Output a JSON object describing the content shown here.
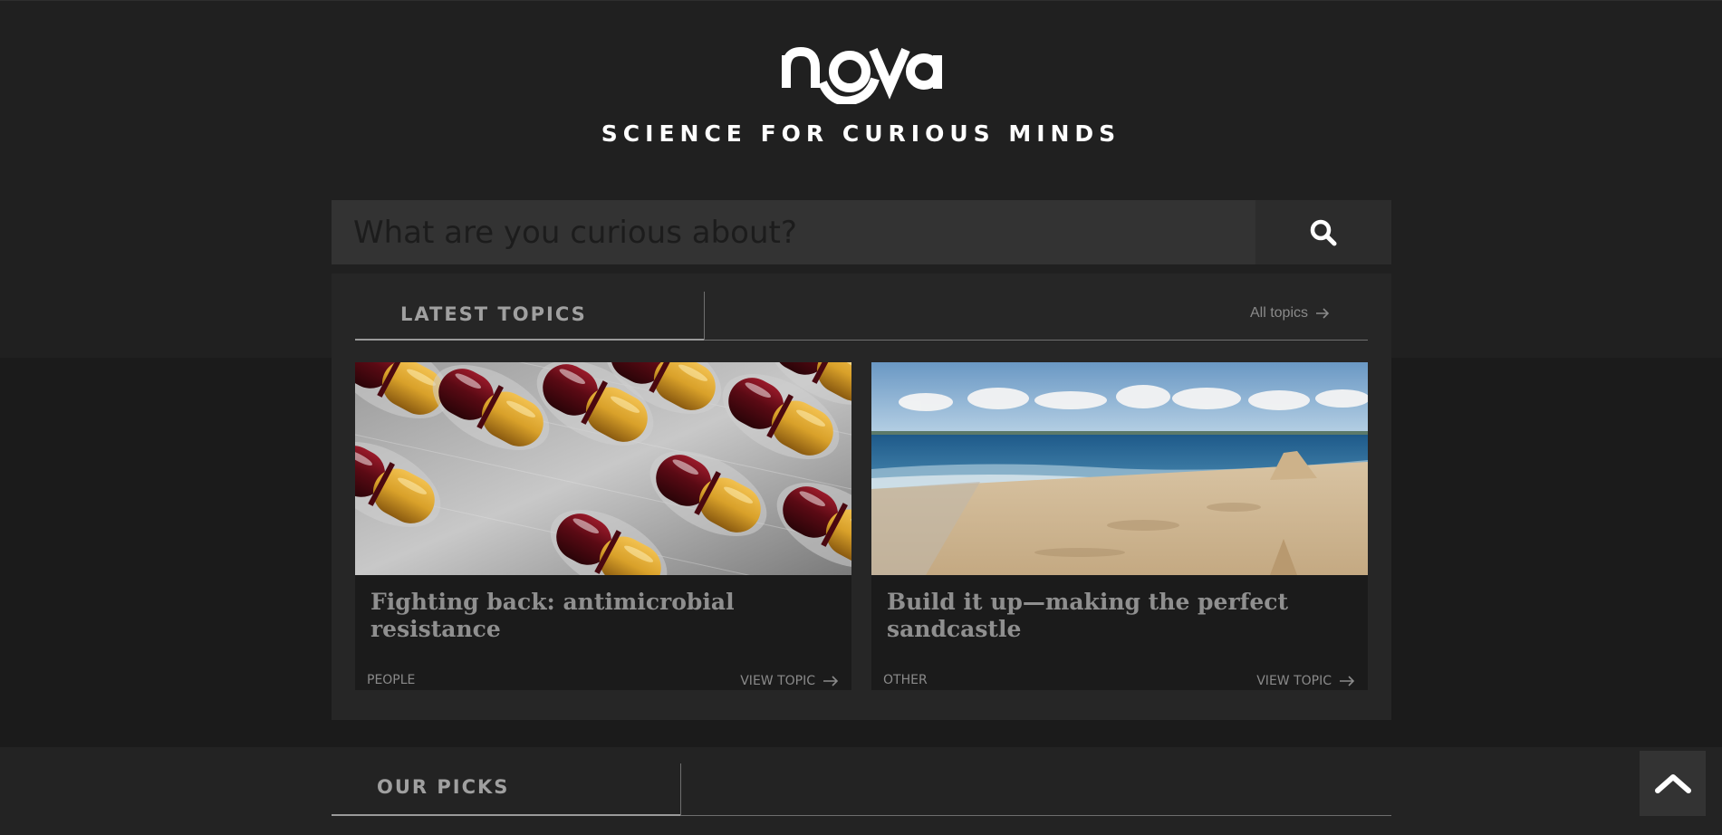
{
  "header": {
    "logo_text": "nova",
    "tagline": "SCIENCE FOR CURIOUS MINDS"
  },
  "search": {
    "placeholder": "What are you curious about?",
    "button_icon": "search-icon"
  },
  "latest_topics": {
    "title": "LATEST TOPICS",
    "all_topics_link": "All topics",
    "cards": [
      {
        "title": "Fighting back: antimicrobial resistance",
        "category": "PEOPLE",
        "view_label": "VIEW TOPIC",
        "image": "capsules-in-blister-pack"
      },
      {
        "title": "Build it up—making the perfect sandcastle",
        "category": "OTHER",
        "view_label": "VIEW TOPIC",
        "image": "beach-with-sandcastle"
      }
    ]
  },
  "our_picks": {
    "title": "OUR PICKS"
  },
  "back_to_top": {
    "icon": "chevron-up-icon"
  },
  "colors": {
    "page_background": "#1b1b1b",
    "hero_background": "#202020",
    "search_background": "#333333",
    "panel_background": "#262626",
    "heading_text": "#a0a0a0",
    "capsule_red": "#5a0a14",
    "capsule_yellow": "#d9a12a",
    "sky_blue": "#7aa6cc",
    "sand": "#d8c3a2"
  }
}
